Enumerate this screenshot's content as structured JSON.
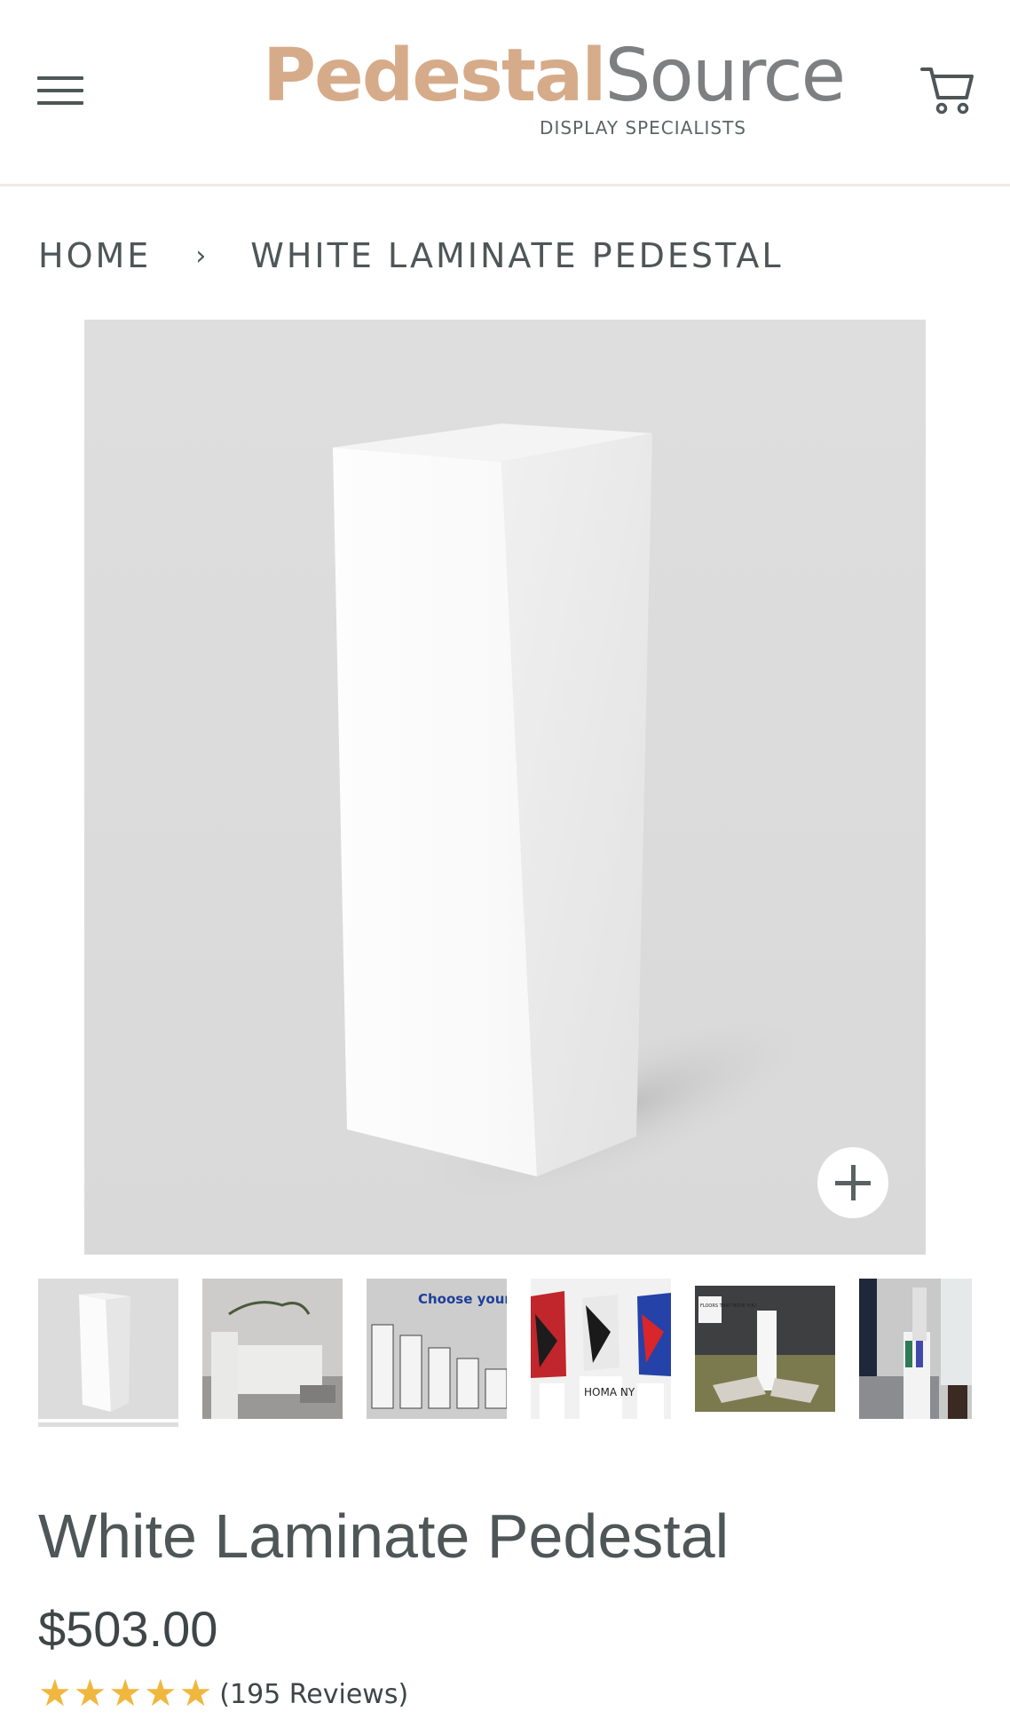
{
  "header": {
    "logo_main_a": "Pedestal",
    "logo_main_b": "Source",
    "logo_sub": "DISPLAY SPECIALISTS",
    "menu_icon": "hamburger-menu-icon",
    "cart_icon": "shopping-cart-icon"
  },
  "breadcrumb": {
    "home": "HOME",
    "separator": "›",
    "current": "WHITE LAMINATE PEDESTAL"
  },
  "gallery": {
    "zoom_icon": "plus-icon",
    "thumbs": [
      {
        "text": "",
        "selected": true
      },
      {
        "text": ""
      },
      {
        "text": "Choose your"
      },
      {
        "text": "HOMA NY"
      },
      {
        "text": "FLOORS THAT MOVE YOU"
      },
      {
        "text": ""
      }
    ]
  },
  "product": {
    "title": "White Laminate Pedestal",
    "price": "$503.00",
    "rating": 5,
    "reviews": "(195 Reviews)"
  },
  "colors": {
    "brand": "#d6ab8a",
    "text": "#4e5657",
    "star": "#f0b73e"
  }
}
